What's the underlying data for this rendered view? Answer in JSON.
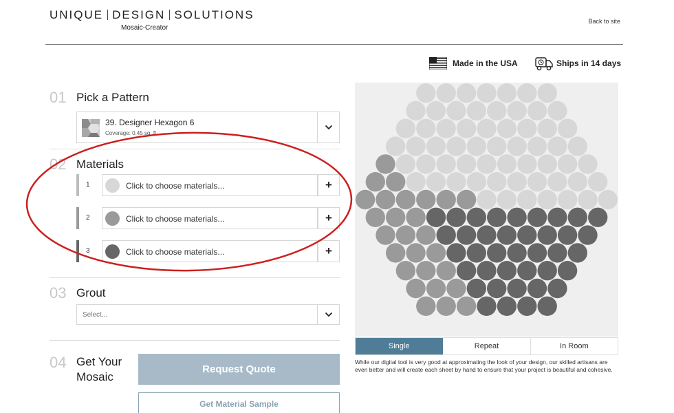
{
  "header": {
    "logo_word1": "UNIQUE",
    "logo_word2": "DESIGN",
    "logo_word3": "SOLUTIONS",
    "subtitle": "Mosaic-Creator",
    "back_link": "Back to site"
  },
  "badges": {
    "made_in": "Made in the USA",
    "ships": "Ships in 14 days"
  },
  "steps": {
    "pattern": {
      "num": "01",
      "title": "Pick a Pattern",
      "selected": "39. Designer Hexagon 6",
      "coverage": "Coverage: 0.45 sq. ft."
    },
    "materials": {
      "num": "02",
      "title": "Materials",
      "rows": [
        {
          "num": "1",
          "label": "Click to choose materials...",
          "swatch": "#d7d7d7",
          "bar": "#bdbdbd"
        },
        {
          "num": "2",
          "label": "Click to choose materials...",
          "swatch": "#9a9a9a",
          "bar": "#999999"
        },
        {
          "num": "3",
          "label": "Click to choose materials...",
          "swatch": "#666666",
          "bar": "#666666"
        }
      ]
    },
    "grout": {
      "num": "03",
      "title": "Grout",
      "placeholder": "Select..."
    },
    "quote": {
      "num": "04",
      "title": "Get Your Mosaic",
      "request_label": "Request Quote",
      "sample_label": "Get Material Sample"
    }
  },
  "preview": {
    "colors": {
      "light": "#d7d7d7",
      "mid": "#9a9a9a",
      "dark": "#666666",
      "bg": "#efefef"
    },
    "tabs": [
      "Single",
      "Repeat",
      "In Room"
    ],
    "active_tab": "Single",
    "disclaimer": "While our digital tool is very good at approximating the look of your design, our skilled artisans are even better and will create each sheet by hand to ensure that your project is beautiful and cohesive."
  },
  "annotation_color": "#cc1f1f"
}
